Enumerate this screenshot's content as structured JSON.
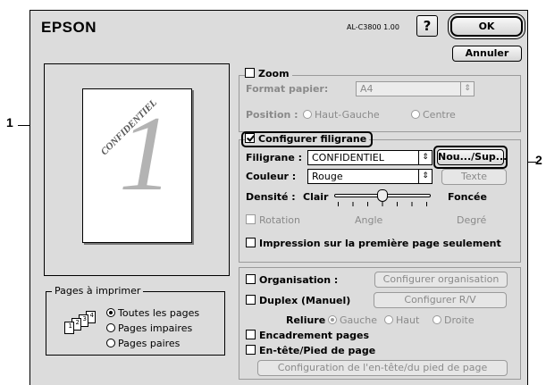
{
  "dialog": {
    "brand": "EPSON",
    "model": "AL-C3800 1.00",
    "help_label": "?",
    "ok_label": "OK",
    "cancel_label": "Annuler"
  },
  "preview": {
    "page_number": "1",
    "watermark_text": "CONFIDENTIEL"
  },
  "pages_group": {
    "title": "Pages à imprimer",
    "icon_numbers": [
      "1",
      "2",
      "3",
      "4"
    ],
    "options": [
      "Toutes les pages",
      "Pages impaires",
      "Pages paires"
    ],
    "selected": "Toutes les pages"
  },
  "zoom": {
    "label": "Zoom",
    "checked": false,
    "format_label": "Format papier:",
    "format_value": "A4",
    "position_label": "Position :",
    "position_options": [
      "Haut-Gauche",
      "Centre"
    ]
  },
  "watermark": {
    "label": "Configurer filigrane",
    "checked": true,
    "filigrane_label": "Filigrane :",
    "filigrane_value": "CONFIDENTIEL",
    "new_delete_label": "Nou.../Sup...",
    "couleur_label": "Couleur :",
    "couleur_value": "Rouge",
    "texte_label": "Texte",
    "densite_label": "Densité :",
    "densite_min": "Clair",
    "densite_max": "Foncée",
    "densite_level": 0.5,
    "rotation_label": "Rotation",
    "angle_label": "Angle",
    "degre_label": "Degré",
    "first_page_label": "Impression sur la première page seulement"
  },
  "layout": {
    "organisation_label": "Organisation :",
    "organisation_button": "Configurer organisation",
    "duplex_label": "Duplex (Manuel)",
    "duplex_button": "Configurer R/V",
    "reliure_label": "Reliure",
    "reliure_options": [
      "Gauche",
      "Haut",
      "Droite"
    ],
    "reliure_selected": "Gauche",
    "encadrement_label": "Encadrement pages",
    "entete_label": "En-tête/Pied de page",
    "entete_button": "Configuration de l'en-tête/du pied de page"
  },
  "callouts": [
    "1",
    "2"
  ]
}
